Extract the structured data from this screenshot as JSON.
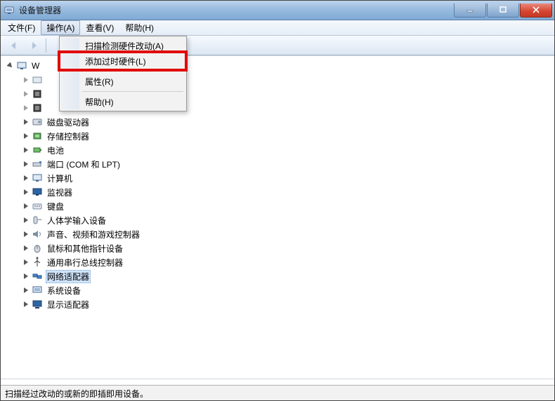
{
  "window": {
    "title": "设备管理器"
  },
  "menubar": {
    "items": [
      {
        "label": "文件(F)"
      },
      {
        "label": "操作(A)",
        "active": true
      },
      {
        "label": "查看(V)"
      },
      {
        "label": "帮助(H)"
      }
    ]
  },
  "dropdown": {
    "items": [
      {
        "label": "扫描检测硬件改动(A)"
      },
      {
        "label": "添加过时硬件(L)",
        "highlighted": true
      },
      {
        "sep": true
      },
      {
        "label": "属性(R)"
      },
      {
        "sep": true
      },
      {
        "label": "帮助(H)"
      }
    ]
  },
  "tree": {
    "root": {
      "label": "W",
      "icon": "computer-icon"
    },
    "nodes": [
      {
        "label": "",
        "icon": "ide-icon",
        "obscured": true
      },
      {
        "label": "",
        "icon": "processor-icon",
        "obscured": true
      },
      {
        "label": "",
        "icon": "processor-icon",
        "obscured": true
      },
      {
        "label": "磁盘驱动器",
        "icon": "disk-icon"
      },
      {
        "label": "存储控制器",
        "icon": "storage-icon"
      },
      {
        "label": "电池",
        "icon": "battery-icon"
      },
      {
        "label": "端口 (COM 和 LPT)",
        "icon": "port-icon"
      },
      {
        "label": "计算机",
        "icon": "computer-icon"
      },
      {
        "label": "监视器",
        "icon": "monitor-icon"
      },
      {
        "label": "键盘",
        "icon": "keyboard-icon"
      },
      {
        "label": "人体学输入设备",
        "icon": "hid-icon"
      },
      {
        "label": "声音、视频和游戏控制器",
        "icon": "sound-icon"
      },
      {
        "label": "鼠标和其他指针设备",
        "icon": "mouse-icon"
      },
      {
        "label": "通用串行总线控制器",
        "icon": "usb-icon"
      },
      {
        "label": "网络适配器",
        "icon": "network-icon",
        "selected": true
      },
      {
        "label": "系统设备",
        "icon": "system-icon"
      },
      {
        "label": "显示适配器",
        "icon": "display-icon"
      }
    ]
  },
  "statusbar": {
    "text": "扫描经过改动的或新的即插即用设备。"
  },
  "colors": {
    "accent": "#cfe3fa",
    "highlight_border": "#e20404"
  }
}
